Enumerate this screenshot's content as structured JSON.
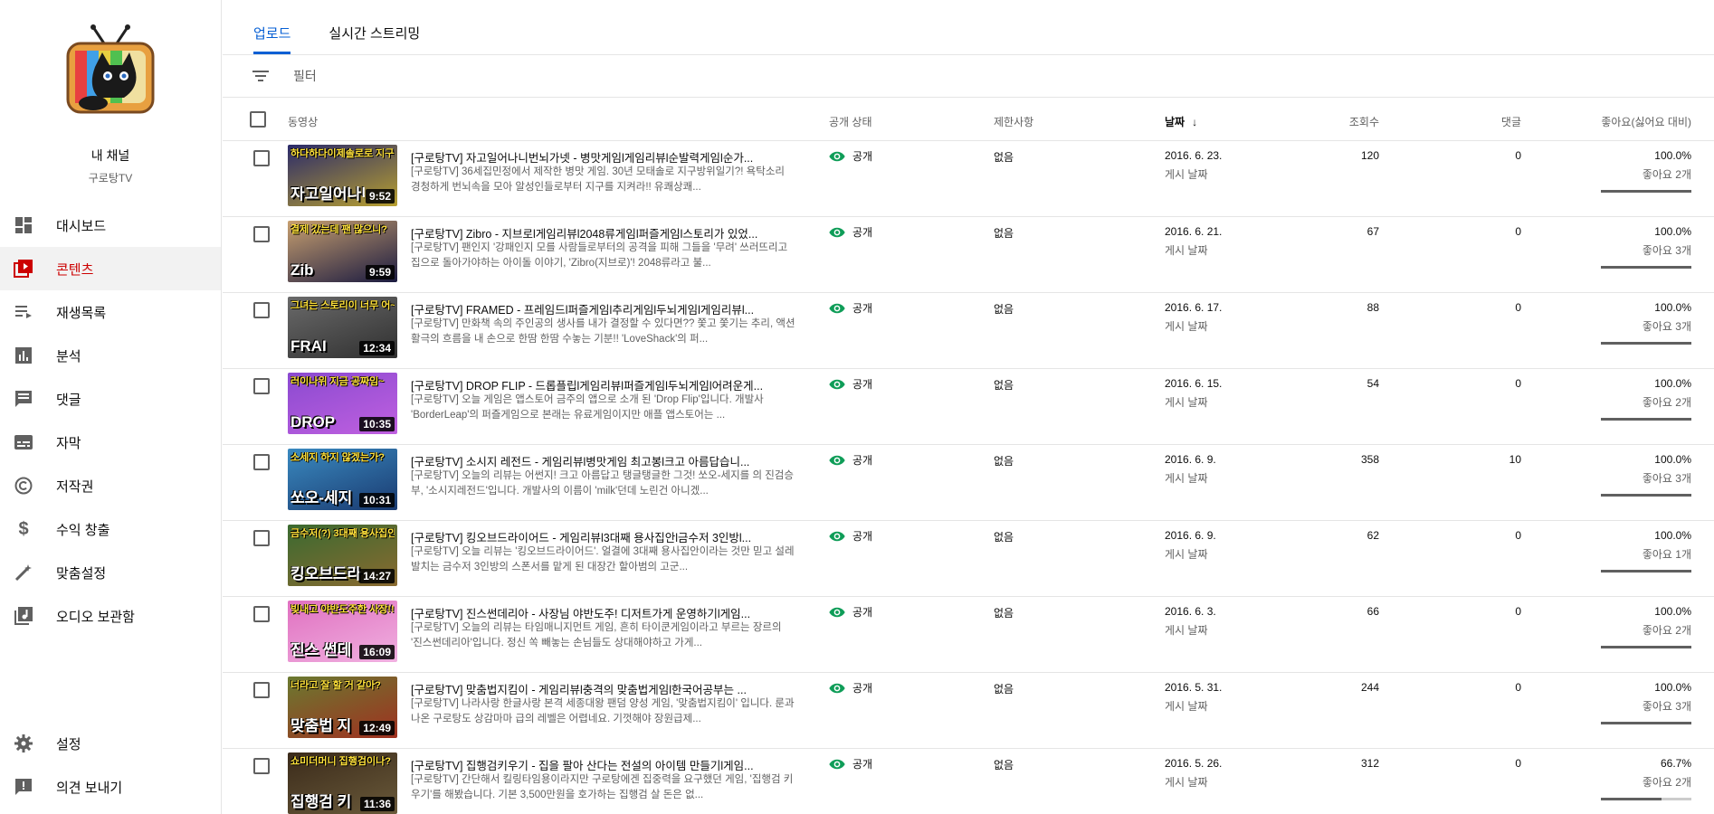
{
  "channel": {
    "name": "내 채널",
    "sub": "구로탕TV"
  },
  "nav": {
    "items": [
      {
        "label": "대시보드",
        "icon": "dashboard-icon"
      },
      {
        "label": "콘텐츠",
        "icon": "content-icon",
        "active": true
      },
      {
        "label": "재생목록",
        "icon": "playlist-icon"
      },
      {
        "label": "분석",
        "icon": "analytics-icon"
      },
      {
        "label": "댓글",
        "icon": "comments-icon"
      },
      {
        "label": "자막",
        "icon": "subtitles-icon"
      },
      {
        "label": "저작권",
        "icon": "copyright-icon"
      },
      {
        "label": "수익 창출",
        "icon": "dollar-icon"
      },
      {
        "label": "맞춤설정",
        "icon": "magic-wand-icon"
      },
      {
        "label": "오디오 보관함",
        "icon": "audio-library-icon"
      }
    ],
    "bottom": [
      {
        "label": "설정",
        "icon": "gear-icon"
      },
      {
        "label": "의견 보내기",
        "icon": "feedback-icon"
      }
    ]
  },
  "tabs": [
    {
      "label": "업로드",
      "active": true
    },
    {
      "label": "실시간 스트리밍"
    }
  ],
  "filter": {
    "label": "필터"
  },
  "columns": {
    "video": "동영상",
    "visibility": "공개 상태",
    "restrictions": "제한사항",
    "date": "날짜",
    "views": "조회수",
    "comments": "댓글",
    "likes": "좋아요(싫어요 대비)"
  },
  "colors": {
    "accent": "#065fd4",
    "active_nav": "#cc0000",
    "visibility_icon": "#0f9d58"
  },
  "rows": [
    {
      "title": "[구로탕TV] 자고일어나니번뇌가넷 - 병맛게임l게임리뷰l순발력게임l순가...",
      "desc": "[구로탕TV] 36세집민정에서 제작한 병맛 게임. 30년 모태솔로 지구방위일기?! 욕탁소리 경청하게 번뇌속을 모아 알성인들로부터 지구를 지켜라!! 유쾌상쾌...",
      "duration": "9:52",
      "thumb_top": "하다하다이제솔로로 지구를 지켜라!",
      "thumb_main": "자고일어나니 번",
      "thumb_bg": [
        "#2a2a6a",
        "#b8a030"
      ],
      "visibility": "공개",
      "restriction": "없음",
      "date": "2016. 6. 23.",
      "date_sub": "게시 날짜",
      "views": "120",
      "comments": "0",
      "like_pct": "100.0%",
      "like_count": "좋아요 2개",
      "like_ratio": 1.0
    },
    {
      "title": "[구로탕TV] Zibro - 지브로l게임리뷰l2048류게임l퍼즐게임l스토리가 있었...",
      "desc": "[구로탕TV] 팬인지 '강패인지 모를 사람들로부터의 공격을 피해 그들을 '무려' 쓰러뜨리고 집으로 돌아가야하는 아이돌 이야기, 'Zibro(지브로)'! 2048류라고 불...",
      "duration": "9:59",
      "thumb_top": "결제 갔는데 팬 많으니?",
      "thumb_main": "Zib",
      "thumb_bg": [
        "#c8a070",
        "#1a1a40"
      ],
      "visibility": "공개",
      "restriction": "없음",
      "date": "2016. 6. 21.",
      "date_sub": "게시 날짜",
      "views": "67",
      "comments": "0",
      "like_pct": "100.0%",
      "like_count": "좋아요 3개",
      "like_ratio": 1.0
    },
    {
      "title": "[구로탕TV] FRAMED - 프레임드l퍼즐게임l추리게임l두뇌게임l게임리뷰l...",
      "desc": "[구로탕TV] 만화책 속의 주인공의 생사를 내가 결정할 수 있다면?? 쫓고 쫓기는 추리, 액션 활극의 흐름을 내 손으로 한땀 한땀 수놓는 기분!! 'LoveShack'의 퍼...",
      "duration": "12:34",
      "thumb_top": "그녀는 스토리이 너무 어~렵",
      "thumb_main": "FRAI",
      "thumb_bg": [
        "#6a6a6a",
        "#303030"
      ],
      "visibility": "공개",
      "restriction": "없음",
      "date": "2016. 6. 17.",
      "date_sub": "게시 날짜",
      "views": "88",
      "comments": "0",
      "like_pct": "100.0%",
      "like_count": "좋아요 3개",
      "like_ratio": 1.0
    },
    {
      "title": "[구로탕TV] DROP FLIP - 드롭플립l게임리뷰l퍼즐게임l두뇌게임l어려운게...",
      "desc": "[구로탕TV] 오늘 게임은 앱스토어 금주의 앱으로 소개 된 'Drop Flip'입니다. 개발사 'BorderLeap'의 퍼즐게임으로 본래는 유료게임이지만 애플 앱스토어는 ...",
      "duration": "10:35",
      "thumb_top": "러이나위 지금 공짜임~",
      "thumb_main": "DROP",
      "thumb_bg": [
        "#8a4ad0",
        "#c060e0"
      ],
      "visibility": "공개",
      "restriction": "없음",
      "date": "2016. 6. 15.",
      "date_sub": "게시 날짜",
      "views": "54",
      "comments": "0",
      "like_pct": "100.0%",
      "like_count": "좋아요 2개",
      "like_ratio": 1.0
    },
    {
      "title": "[구로탕TV] 소시지 레전드 - 게임리뷰l병맛게임 최고봉l크고 아름답습니...",
      "desc": "[구로탕TV] 오늘의 리뷰는 어썬지! 크고 아름답고 탱글탱글한 그것! 쏘오-세지를 의 진검승부, '소시지레전드'입니다. 개발사의 이름이 'milk'던데 노린건 아니겠...",
      "duration": "10:31",
      "thumb_top": "소세지 하지 않겠는가?",
      "thumb_main": "쏘오-세지",
      "thumb_bg": [
        "#3a8ac0",
        "#1a3a70"
      ],
      "visibility": "공개",
      "restriction": "없음",
      "date": "2016. 6. 9.",
      "date_sub": "게시 날짜",
      "views": "358",
      "comments": "10",
      "like_pct": "100.0%",
      "like_count": "좋아요 3개",
      "like_ratio": 1.0
    },
    {
      "title": "[구로탕TV] 킹오브드라이어드 - 게임리뷰l3대째 용사집안l금수저 3인방l...",
      "desc": "[구로탕TV] 오늘 리뷰는 '킹오브드라이어드'. 얼결에 3대째 용사집안이라는 것만 믿고 설레발치는 금수저 3인방의 스폰서를 맡게 된 대장간 할아범의 고군...",
      "duration": "14:27",
      "thumb_top": "금수저(?) 3대째 용사집안",
      "thumb_main": "킹오브드라",
      "thumb_bg": [
        "#3a6a30",
        "#8a6a30"
      ],
      "visibility": "공개",
      "restriction": "없음",
      "date": "2016. 6. 9.",
      "date_sub": "게시 날짜",
      "views": "62",
      "comments": "0",
      "like_pct": "100.0%",
      "like_count": "좋아요 1개",
      "like_ratio": 1.0
    },
    {
      "title": "[구로탕TV] 진스썬데리아 - 사장님 야반도주! 디저트가게 운영하기l게임...",
      "desc": "[구로탕TV] 오늘의 리뷰는 타임매니지먼트 게임, 흔히 타이쿤게임이라고 부르는 장르의 '진스썬데리아'입니다. 정신 쏙 빼놓는 손님들도 상대해야하고 가게...",
      "duration": "16:09",
      "thumb_top": "빚내고 야반도주한 사장!!",
      "thumb_main": "진스 썬데",
      "thumb_bg": [
        "#e070c0",
        "#f0b0e0"
      ],
      "visibility": "공개",
      "restriction": "없음",
      "date": "2016. 6. 3.",
      "date_sub": "게시 날짜",
      "views": "66",
      "comments": "0",
      "like_pct": "100.0%",
      "like_count": "좋아요 2개",
      "like_ratio": 1.0
    },
    {
      "title": "[구로탕TV] 맞춤법지킴이 - 게임리뷰l충격의 맞춤법게임l한국어공부는 ...",
      "desc": "[구로탕TV] 나라사랑 한글사랑 본격 세종대왕 팬덤 양성 게임, '맞춤법지킴이' 입니다. 룬과 나온 구로탕도 상감마마 급의 레벨은 어렵네요. 기껏해야 장원급제...",
      "duration": "12:49",
      "thumb_top": "너라고 잘 할 거 같아?",
      "thumb_main": "맞춤법 지",
      "thumb_bg": [
        "#6a7a30",
        "#a03020"
      ],
      "visibility": "공개",
      "restriction": "없음",
      "date": "2016. 5. 31.",
      "date_sub": "게시 날짜",
      "views": "244",
      "comments": "0",
      "like_pct": "100.0%",
      "like_count": "좋아요 3개",
      "like_ratio": 1.0
    },
    {
      "title": "[구로탕TV] 집행검키우기 - 집을 팔아 산다는 전설의 아이템 만들기l게임...",
      "desc": "[구로탕TV] 간단해서 킬링타임용이라지만 구로탕에겐 집중력을 요구했던 게임, '집행검 키우기'를 해봤습니다. 기본 3,500만원을 호가하는 집행검 살 돈은 없...",
      "duration": "11:36",
      "thumb_top": "쇼미더머니 집행검이나?",
      "thumb_main": "집행검 키",
      "thumb_bg": [
        "#3a2a1a",
        "#6a5a3a"
      ],
      "visibility": "공개",
      "restriction": "없음",
      "date": "2016. 5. 26.",
      "date_sub": "게시 날짜",
      "views": "312",
      "comments": "0",
      "like_pct": "66.7%",
      "like_count": "좋아요 2개",
      "like_ratio": 0.667
    }
  ]
}
